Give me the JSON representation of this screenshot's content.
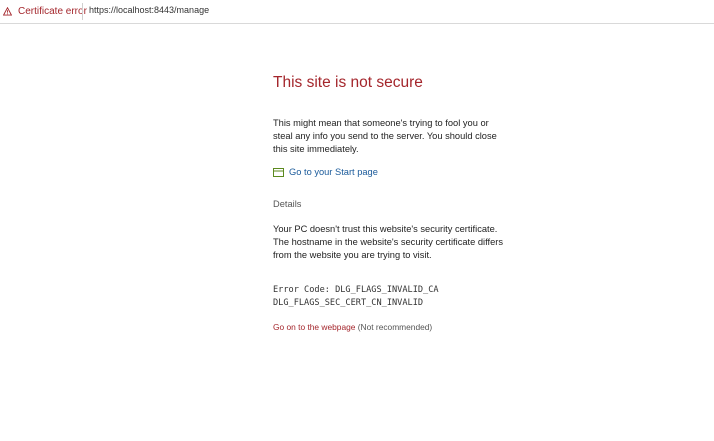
{
  "addressbar": {
    "cert_error_label": "Certificate error",
    "url": "https://localhost:8443/manage"
  },
  "page": {
    "title": "This site is not secure",
    "body": "This might mean that someone's trying to fool you or steal any info you send to the server. You should close this site immediately.",
    "start_link_label": "Go to your Start page",
    "details_heading": "Details",
    "details_line1": "Your PC doesn't trust this website's security certificate.",
    "details_line2": "The hostname in the website's security certificate differs from the website you are trying to visit.",
    "error_code_line1": "Error Code: DLG_FLAGS_INVALID_CA",
    "error_code_line2": "DLG_FLAGS_SEC_CERT_CN_INVALID",
    "go_on_link": "Go on to the webpage",
    "go_on_note": "(Not recommended)"
  },
  "colors": {
    "error_red": "#a4262c",
    "link_blue": "#1a5a9a",
    "start_icon_green": "#5c8a1e"
  },
  "icons": {
    "cert_error": "warning-triangle-icon",
    "start_page": "start-page-icon"
  }
}
